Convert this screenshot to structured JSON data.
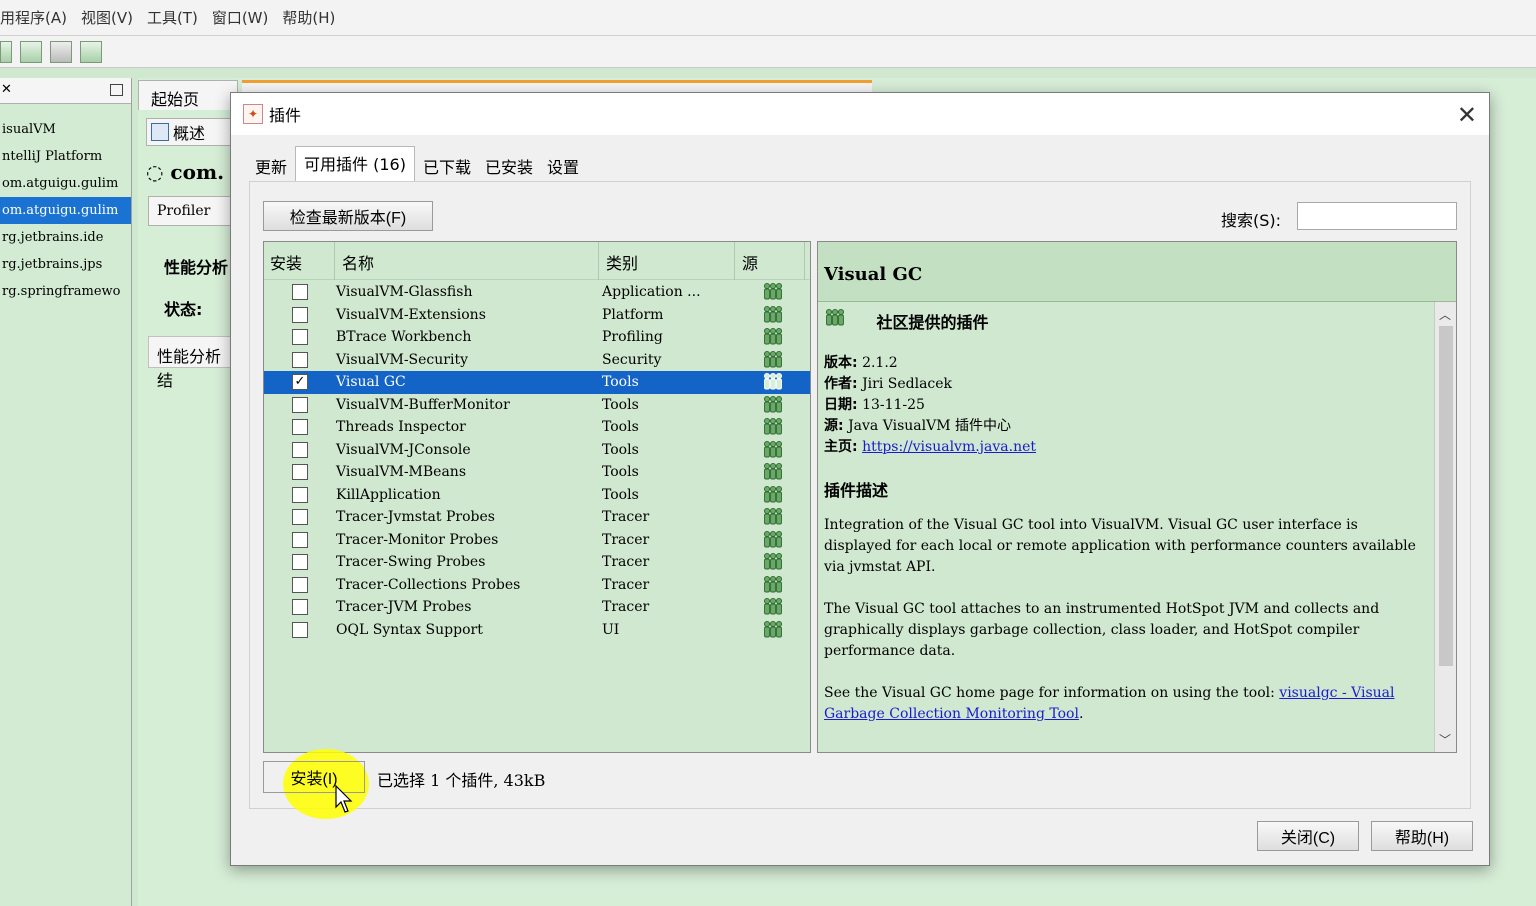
{
  "menubar": {
    "items": [
      "用程序(A)",
      "视图(V)",
      "工具(T)",
      "窗口(W)",
      "帮助(H)"
    ]
  },
  "left_panel": {
    "items": [
      {
        "label": "isualVM"
      },
      {
        "label": "ntelliJ Platform"
      },
      {
        "label": "om.atguigu.gulim"
      },
      {
        "label": "om.atguigu.gulim"
      },
      {
        "label": "rg.jetbrains.ide"
      },
      {
        "label": "rg.jetbrains.jps"
      },
      {
        "label": "rg.springframewo"
      }
    ]
  },
  "background": {
    "start_tab": "起始页",
    "overview_tab": "概述",
    "com_title": "com.",
    "profiler_btn": "Profiler",
    "perf_label": "性能分析",
    "status_label": "状态:",
    "perf_box": "性能分析结"
  },
  "dialog": {
    "title": "插件",
    "tabs": [
      "更新",
      "可用插件 (16)",
      "已下载",
      "已安装",
      "设置"
    ],
    "check_button": "检查最新版本(F)",
    "search_label": "搜索(S):",
    "search_value": "",
    "columns": {
      "install": "安装",
      "name": "名称",
      "category": "类别",
      "source": "源"
    },
    "plugins": [
      {
        "name": "VisualVM-Glassfish",
        "category": "Application ...",
        "checked": false
      },
      {
        "name": "VisualVM-Extensions",
        "category": "Platform",
        "checked": false
      },
      {
        "name": "BTrace Workbench",
        "category": "Profiling",
        "checked": false
      },
      {
        "name": "VisualVM-Security",
        "category": "Security",
        "checked": false
      },
      {
        "name": "Visual GC",
        "category": "Tools",
        "checked": true
      },
      {
        "name": "VisualVM-BufferMonitor",
        "category": "Tools",
        "checked": false
      },
      {
        "name": "Threads Inspector",
        "category": "Tools",
        "checked": false
      },
      {
        "name": "VisualVM-JConsole",
        "category": "Tools",
        "checked": false
      },
      {
        "name": "VisualVM-MBeans",
        "category": "Tools",
        "checked": false
      },
      {
        "name": "KillApplication",
        "category": "Tools",
        "checked": false
      },
      {
        "name": "Tracer-Jvmstat Probes",
        "category": "Tracer",
        "checked": false
      },
      {
        "name": "Tracer-Monitor Probes",
        "category": "Tracer",
        "checked": false
      },
      {
        "name": "Tracer-Swing Probes",
        "category": "Tracer",
        "checked": false
      },
      {
        "name": "Tracer-Collections Probes",
        "category": "Tracer",
        "checked": false
      },
      {
        "name": "Tracer-JVM Probes",
        "category": "Tracer",
        "checked": false
      },
      {
        "name": "OQL Syntax Support",
        "category": "UI",
        "checked": false
      }
    ],
    "selected_index": 4,
    "detail": {
      "title": "Visual GC",
      "community": "社区提供的插件",
      "version_label": "版本:",
      "version": "2.1.2",
      "author_label": "作者:",
      "author": "Jiri Sedlacek",
      "date_label": "日期:",
      "date": "13-11-25",
      "source_label": "源:",
      "source": "Java VisualVM 插件中心",
      "homepage_label": "主页:",
      "homepage": "https://visualvm.java.net",
      "desc_heading": "插件描述",
      "desc1": "Integration of the Visual GC tool into VisualVM. Visual GC user interface is displayed for each local or remote application with performance counters available via jvmstat API.",
      "desc2": "The Visual GC tool attaches to an instrumented HotSpot JVM and collects and graphically displays garbage collection, class loader, and HotSpot compiler performance data.",
      "desc3": "See the Visual GC home page for information on using the tool:",
      "desc3_link": "visualgc - Visual Garbage Collection Monitoring Tool",
      "desc3_end": "."
    },
    "install_button": "安装(I)",
    "selection_status": "已选择 1 个插件, 43kB",
    "close_button": "关闭(C)",
    "help_button": "帮助(H)"
  }
}
